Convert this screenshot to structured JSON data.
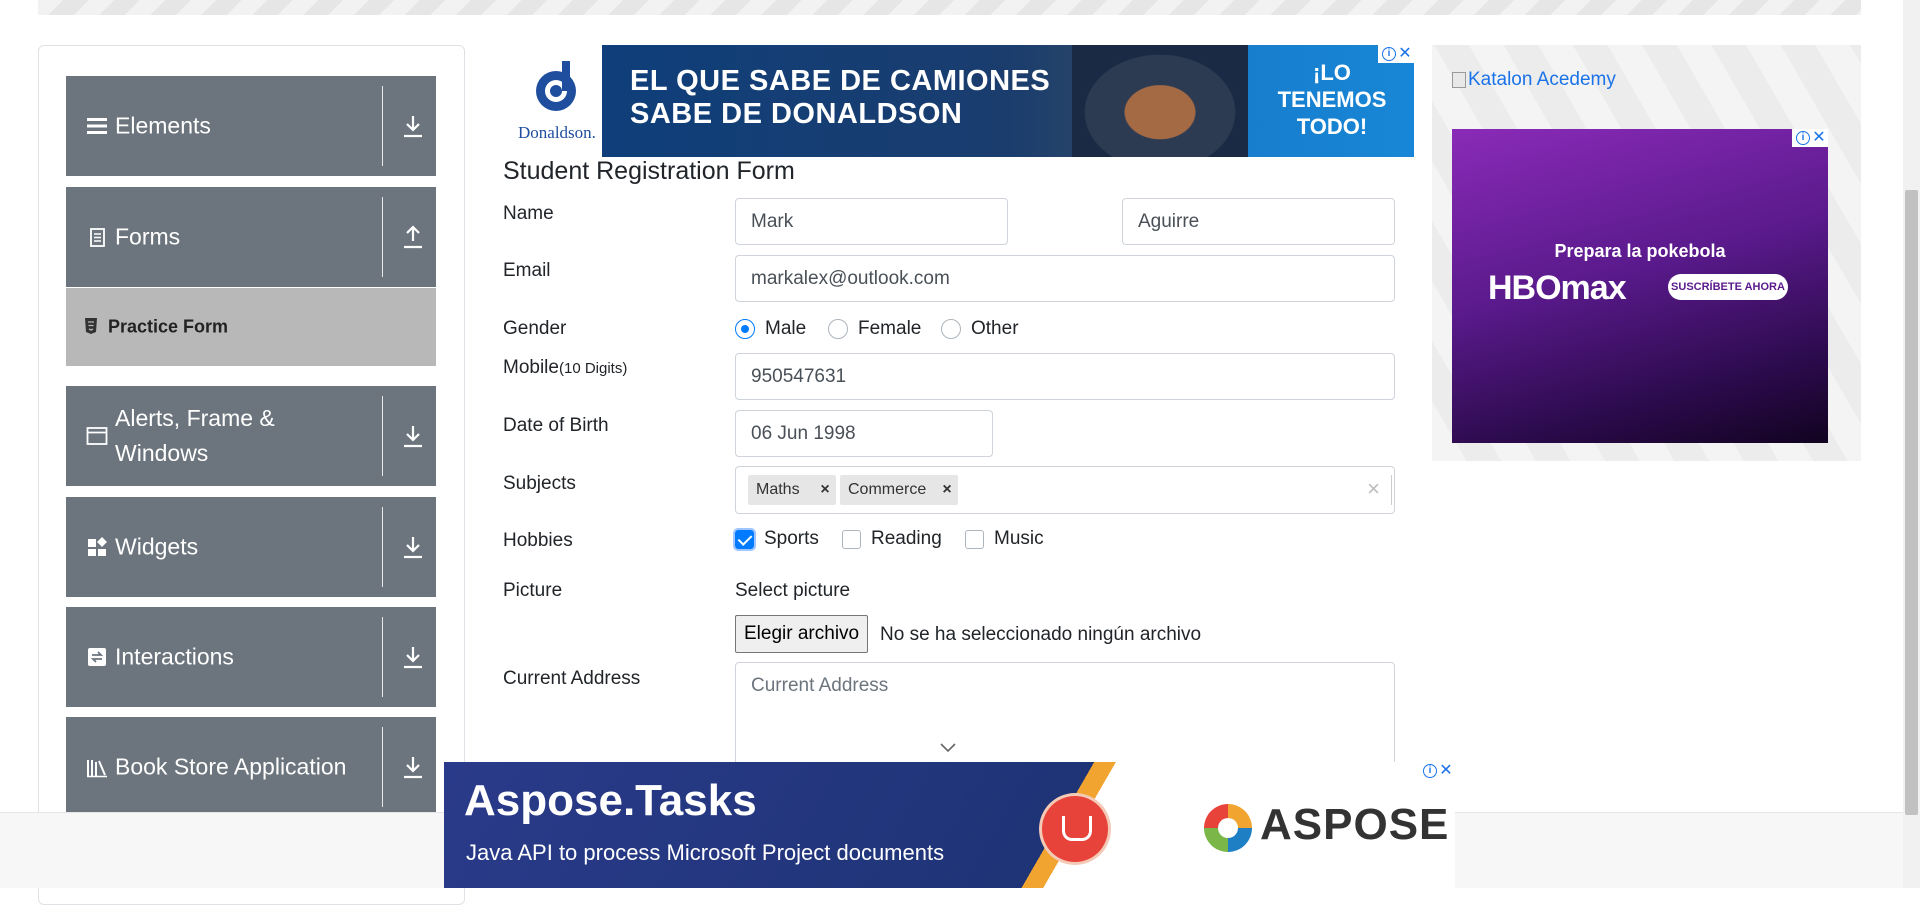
{
  "sidebar": {
    "groups": [
      {
        "label": "Elements"
      },
      {
        "label": "Forms"
      },
      {
        "label": "Alerts, Frame & Windows"
      },
      {
        "label": "Widgets"
      },
      {
        "label": "Interactions"
      },
      {
        "label": "Book Store Application"
      }
    ],
    "active_item": "Practice Form"
  },
  "ads": {
    "top": {
      "brand": "Donaldson.",
      "headline_line1": "EL QUE SABE DE CAMIONES",
      "headline_line2": "SABE DE DONALDSON",
      "tagline": "¡LO TENEMOS TODO!"
    },
    "right": {
      "link_text": "Katalon Acedemy",
      "promo": "Prepara la pokebola",
      "brand": "HBOmax",
      "cta": "SUSCRÍBETE AHORA"
    },
    "bottom": {
      "title": "Aspose.Tasks",
      "subtitle": "Java API to process Microsoft Project documents",
      "brand": "ASPOSE"
    }
  },
  "form": {
    "title": "Student Registration Form",
    "name_label": "Name",
    "first_name": "Mark",
    "last_name": "Aguirre",
    "email_label": "Email",
    "email": "markalex@outlook.com",
    "gender_label": "Gender",
    "gender_options": [
      "Male",
      "Female",
      "Other"
    ],
    "gender_selected": "Male",
    "mobile_label": "Mobile",
    "mobile_hint": "(10 Digits)",
    "mobile": "950547631",
    "dob_label": "Date of Birth",
    "dob": "06 Jun 1998",
    "subjects_label": "Subjects",
    "subjects": [
      "Maths",
      "Commerce"
    ],
    "chip_remove": "×",
    "clear": "×",
    "hobbies_label": "Hobbies",
    "hobbies": [
      "Sports",
      "Reading",
      "Music"
    ],
    "hobbies_checked": [
      "Sports"
    ],
    "picture_label": "Picture",
    "picture_select": "Select picture",
    "file_button": "Elegir archivo",
    "file_status": "No se ha seleccionado ningún archivo",
    "address_label": "Current Address",
    "address_placeholder": "Current Address"
  }
}
